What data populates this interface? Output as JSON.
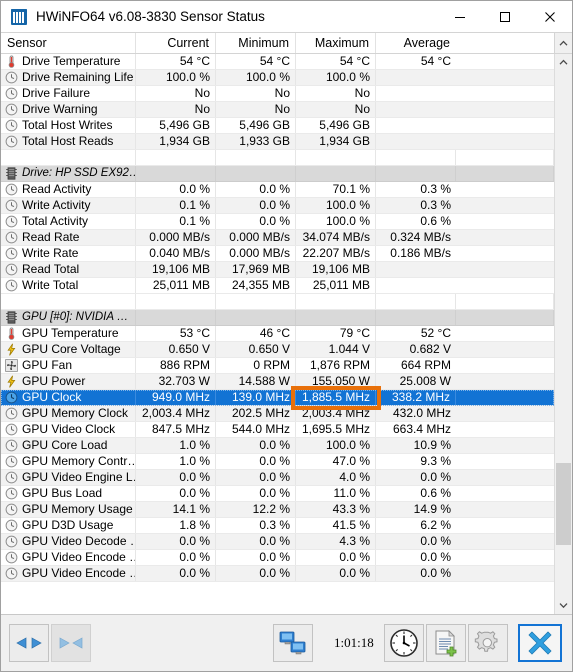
{
  "window": {
    "title": "HWiNFO64 v6.08-3830 Sensor Status",
    "app_icon": "hwinfo-bars-icon",
    "minimize_label": "Minimize",
    "maximize_label": "Maximize",
    "close_label": "Close"
  },
  "colors": {
    "selection": "#1273d4",
    "highlight_box": "#e8700a",
    "section_bg": "#d9d9d9",
    "alt_row_bg": "#f2f2f2"
  },
  "grid": {
    "columns": [
      "Sensor",
      "Current",
      "Minimum",
      "Maximum",
      "Average"
    ],
    "rows": [
      {
        "type": "data",
        "icon": "thermometer-icon",
        "name": "Drive Temperature",
        "current": "54 °C",
        "minimum": "54 °C",
        "maximum": "54 °C",
        "average": "54 °C"
      },
      {
        "type": "data",
        "icon": "gauge-icon",
        "name": "Drive Remaining Life",
        "current": "100.0 %",
        "minimum": "100.0 %",
        "maximum": "100.0 %",
        "average": ""
      },
      {
        "type": "data",
        "icon": "gauge-icon",
        "name": "Drive Failure",
        "current": "No",
        "minimum": "No",
        "maximum": "No",
        "average": ""
      },
      {
        "type": "data",
        "icon": "gauge-icon",
        "name": "Drive Warning",
        "current": "No",
        "minimum": "No",
        "maximum": "No",
        "average": ""
      },
      {
        "type": "data",
        "icon": "gauge-icon",
        "name": "Total Host Writes",
        "current": "5,496 GB",
        "minimum": "5,496 GB",
        "maximum": "5,496 GB",
        "average": ""
      },
      {
        "type": "data",
        "icon": "gauge-icon",
        "name": "Total Host Reads",
        "current": "1,934 GB",
        "minimum": "1,933 GB",
        "maximum": "1,934 GB",
        "average": ""
      },
      {
        "type": "spacer",
        "icon": "",
        "name": "",
        "current": "",
        "minimum": "",
        "maximum": "",
        "average": ""
      },
      {
        "type": "section",
        "icon": "chip-icon",
        "name": "Drive: HP SSD EX92…",
        "current": "",
        "minimum": "",
        "maximum": "",
        "average": ""
      },
      {
        "type": "data",
        "icon": "gauge-icon",
        "name": "Read Activity",
        "current": "0.0 %",
        "minimum": "0.0 %",
        "maximum": "70.1 %",
        "average": "0.3 %"
      },
      {
        "type": "data",
        "icon": "gauge-icon",
        "name": "Write Activity",
        "current": "0.1 %",
        "minimum": "0.0 %",
        "maximum": "100.0 %",
        "average": "0.3 %"
      },
      {
        "type": "data",
        "icon": "gauge-icon",
        "name": "Total Activity",
        "current": "0.1 %",
        "minimum": "0.0 %",
        "maximum": "100.0 %",
        "average": "0.6 %"
      },
      {
        "type": "data",
        "icon": "gauge-icon",
        "name": "Read Rate",
        "current": "0.000 MB/s",
        "minimum": "0.000 MB/s",
        "maximum": "34.074 MB/s",
        "average": "0.324 MB/s"
      },
      {
        "type": "data",
        "icon": "gauge-icon",
        "name": "Write Rate",
        "current": "0.040 MB/s",
        "minimum": "0.000 MB/s",
        "maximum": "22.207 MB/s",
        "average": "0.186 MB/s"
      },
      {
        "type": "data",
        "icon": "gauge-icon",
        "name": "Read Total",
        "current": "19,106 MB",
        "minimum": "17,969 MB",
        "maximum": "19,106 MB",
        "average": ""
      },
      {
        "type": "data",
        "icon": "gauge-icon",
        "name": "Write Total",
        "current": "25,011 MB",
        "minimum": "24,355 MB",
        "maximum": "25,011 MB",
        "average": ""
      },
      {
        "type": "spacer",
        "icon": "",
        "name": "",
        "current": "",
        "minimum": "",
        "maximum": "",
        "average": ""
      },
      {
        "type": "section",
        "icon": "chip-icon",
        "name": "GPU [#0]: NVIDIA …",
        "current": "",
        "minimum": "",
        "maximum": "",
        "average": ""
      },
      {
        "type": "data",
        "icon": "thermometer-icon",
        "name": "GPU Temperature",
        "current": "53 °C",
        "minimum": "46 °C",
        "maximum": "79 °C",
        "average": "52 °C"
      },
      {
        "type": "data",
        "icon": "bolt-icon",
        "name": "GPU Core Voltage",
        "current": "0.650 V",
        "minimum": "0.650 V",
        "maximum": "1.044 V",
        "average": "0.682 V"
      },
      {
        "type": "data",
        "icon": "fan-icon",
        "name": "GPU Fan",
        "current": "886 RPM",
        "minimum": "0 RPM",
        "maximum": "1,876 RPM",
        "average": "664 RPM"
      },
      {
        "type": "data",
        "icon": "bolt-icon",
        "name": "GPU Power",
        "current": "32.703 W",
        "minimum": "14.588 W",
        "maximum": "155.050 W",
        "average": "25.008 W"
      },
      {
        "type": "selected",
        "icon": "clock-blue-icon",
        "name": "GPU Clock",
        "current": "949.0 MHz",
        "minimum": "139.0 MHz",
        "maximum": "1,885.5 MHz",
        "average": "338.2 MHz"
      },
      {
        "type": "data",
        "icon": "gauge-icon",
        "name": "GPU Memory Clock",
        "current": "2,003.4 MHz",
        "minimum": "202.5 MHz",
        "maximum": "2,003.4 MHz",
        "average": "432.0 MHz"
      },
      {
        "type": "data",
        "icon": "gauge-icon",
        "name": "GPU Video Clock",
        "current": "847.5 MHz",
        "minimum": "544.0 MHz",
        "maximum": "1,695.5 MHz",
        "average": "663.4 MHz"
      },
      {
        "type": "data",
        "icon": "gauge-icon",
        "name": "GPU Core Load",
        "current": "1.0 %",
        "minimum": "0.0 %",
        "maximum": "100.0 %",
        "average": "10.9 %"
      },
      {
        "type": "data",
        "icon": "gauge-icon",
        "name": "GPU Memory Contr…",
        "current": "1.0 %",
        "minimum": "0.0 %",
        "maximum": "47.0 %",
        "average": "9.3 %"
      },
      {
        "type": "data",
        "icon": "gauge-icon",
        "name": "GPU Video Engine L…",
        "current": "0.0 %",
        "minimum": "0.0 %",
        "maximum": "4.0 %",
        "average": "0.0 %"
      },
      {
        "type": "data",
        "icon": "gauge-icon",
        "name": "GPU Bus Load",
        "current": "0.0 %",
        "minimum": "0.0 %",
        "maximum": "11.0 %",
        "average": "0.6 %"
      },
      {
        "type": "data",
        "icon": "gauge-icon",
        "name": "GPU Memory Usage",
        "current": "14.1 %",
        "minimum": "12.2 %",
        "maximum": "43.3 %",
        "average": "14.9 %"
      },
      {
        "type": "data",
        "icon": "gauge-icon",
        "name": "GPU D3D Usage",
        "current": "1.8 %",
        "minimum": "0.3 %",
        "maximum": "41.5 %",
        "average": "6.2 %"
      },
      {
        "type": "data",
        "icon": "gauge-icon",
        "name": "GPU Video Decode …",
        "current": "0.0 %",
        "minimum": "0.0 %",
        "maximum": "4.3 %",
        "average": "0.0 %"
      },
      {
        "type": "data",
        "icon": "gauge-icon",
        "name": "GPU Video Encode …",
        "current": "0.0 %",
        "minimum": "0.0 %",
        "maximum": "0.0 %",
        "average": "0.0 %"
      },
      {
        "type": "data",
        "icon": "gauge-icon",
        "name": "GPU Video Encode …",
        "current": "0.0 %",
        "minimum": "0.0 %",
        "maximum": "0.0 %",
        "average": "0.0 %"
      }
    ]
  },
  "scrollbar": {
    "up_arrow": "scroll-up-icon",
    "down_arrow": "scroll-down-icon"
  },
  "toolbar": {
    "expand_label": "Expand all",
    "collapse_label": "Collapse all",
    "remote_label": "Remote monitoring",
    "elapsed_time": "1:01:18",
    "clock_label": "Reset timer",
    "logging_label": "Start logging",
    "settings_label": "Configure sensors",
    "close_label": "Close"
  }
}
